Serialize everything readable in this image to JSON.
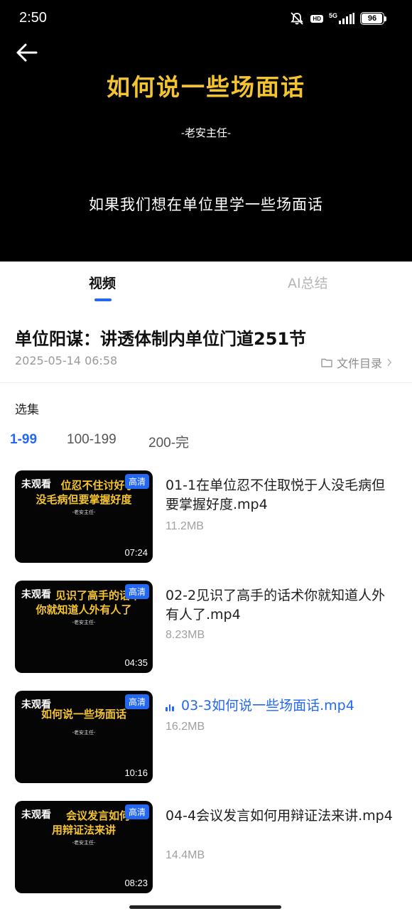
{
  "status_bar": {
    "time": "2:50",
    "network_label": "5G",
    "hd_badge": "HD",
    "battery_level": "96",
    "battery_fraction": 0.96,
    "icons": [
      "mute-icon",
      "hd-icon",
      "signal-icon",
      "battery-icon"
    ]
  },
  "player": {
    "back_icon": "arrow-left-icon",
    "slide_title": "如何说一些场面话",
    "slide_author": "-老安主任-",
    "slide_subtitle": "如果我们想在单位里学一些场面话"
  },
  "tabs": [
    {
      "label": "视频",
      "active": true
    },
    {
      "label": "AI总结",
      "active": false
    }
  ],
  "course": {
    "title": "单位阳谋：讲透体制内单位门道251节",
    "date": "2025-05-14 06:58",
    "catalog_label": "文件目录"
  },
  "episodes_label": "选集",
  "ranges": [
    {
      "label": "1-99",
      "active": true
    },
    {
      "label": "100-199",
      "active": false
    },
    {
      "label": "200-完",
      "active": false
    }
  ],
  "episodes": [
    {
      "unwatched": "未观看",
      "quality": "高清",
      "thumb_line1": "位忍不住讨好于",
      "thumb_line2": "没毛病但要掌握好度",
      "thumb_author": "-老安主任-",
      "duration": "07:24",
      "title": "01-1在单位忍不住取悦于人没毛病但要掌握好度.mp4",
      "size": "11.2MB",
      "playing": false
    },
    {
      "unwatched": "未观看",
      "quality": "高清",
      "thumb_line1": "见识了高手的话术",
      "thumb_line2": "你就知道人外有人了",
      "thumb_author": "-老安主任-",
      "duration": "04:35",
      "title": "02-2见识了高手的话术你就知道人外有人了.mp4",
      "size": "8.23MB",
      "playing": false
    },
    {
      "unwatched": "未观看",
      "quality": "高清",
      "thumb_line1": "如何说一些场面话",
      "thumb_line2": "",
      "thumb_author": "-老安主任-",
      "duration": "10:16",
      "title": "03-3如何说一些场面话.mp4",
      "size": "16.2MB",
      "playing": true
    },
    {
      "unwatched": "未观看",
      "quality": "高清",
      "thumb_line1": "会议发言如何",
      "thumb_line2": "用辩证法来讲",
      "thumb_author": "-老安主任-",
      "duration": "08:23",
      "title": "04-4会议发言如何用辩证法来讲.mp4",
      "size": "14.4MB",
      "playing": false
    }
  ],
  "colors": {
    "accent": "#2468f2",
    "slide_gold": "#f4c430",
    "player_bg": "#000000"
  }
}
